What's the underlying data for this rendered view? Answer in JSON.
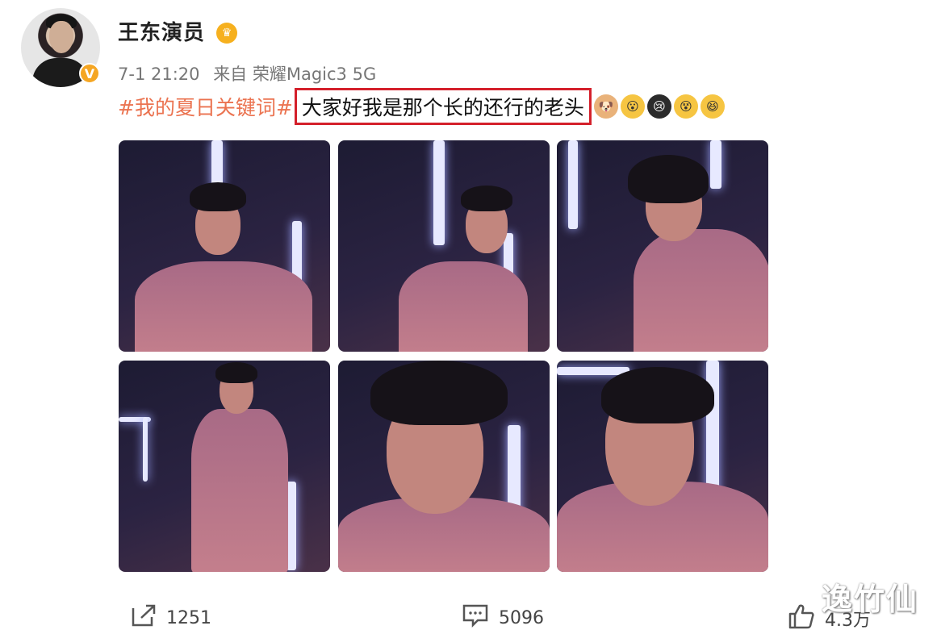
{
  "post": {
    "username": "王东演员",
    "time": "7-1 21:20",
    "source": "来自 荣耀Magic3 5G",
    "hashtag": "#我的夏日关键词#",
    "highlighted_text": "大家好我是那个长的还行的老头"
  },
  "icons": {
    "verified": "verified-v-icon",
    "member": "crown-icon",
    "emojis": [
      "dog-emoji-icon",
      "surprised-emoji-icon",
      "crying-emoji-icon",
      "dizzy-emoji-icon",
      "grinning-emoji-icon"
    ]
  },
  "photos_count": 6,
  "actions": {
    "share_count": "1251",
    "comment_count": "5096",
    "like_count": "4.3万"
  },
  "watermark": "逸竹仙",
  "colors": {
    "hashtag": "#eb7350",
    "highlight_border": "#d4202b",
    "verified": "#f5a623"
  }
}
